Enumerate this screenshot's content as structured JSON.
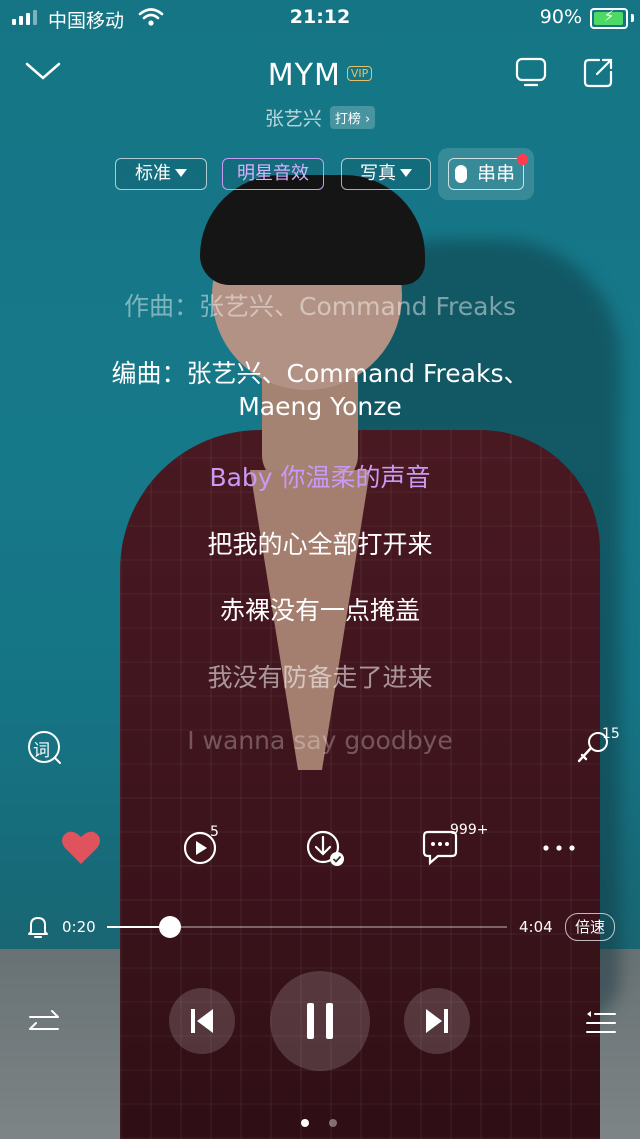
{
  "status_bar": {
    "carrier": "中国移动",
    "time": "21:12",
    "battery": "90%"
  },
  "header": {
    "title": "MYM",
    "vip_badge": "VIP",
    "artist": "张艺兴",
    "rank_label": "打榜 ›"
  },
  "modes": {
    "standard": "标准",
    "star_effect": "明星音效",
    "photo": "写真",
    "chuan": "串串"
  },
  "lyrics": [
    "作曲：张艺兴、Command Freaks",
    "编曲：张艺兴、Command Freaks、",
    "Maeng Yonze",
    "Baby 你温柔的声音",
    "把我的心全部打开来",
    "赤裸没有一点掩盖",
    "我没有防备走了进来",
    "I wanna say goodbye"
  ],
  "side": {
    "lyrics_icon_label": "词",
    "mic_count": "15"
  },
  "actions": {
    "video_count": "5",
    "comment_count": "999+"
  },
  "progress": {
    "current": "0:20",
    "total": "4:04",
    "fraction": 0.082,
    "speed_label": "倍速"
  },
  "colors": {
    "accent_purple": "#c89af5",
    "heart_red": "#e0525c",
    "vip_gold": "#e6c06a"
  },
  "icons": [
    "chevron-down-icon",
    "tv-icon",
    "share-icon",
    "lyrics-icon",
    "mic-icon",
    "heart-icon",
    "video-icon",
    "download-icon",
    "comment-icon",
    "more-icon",
    "alarm-icon",
    "shuffle-icon",
    "prev-icon",
    "pause-icon",
    "next-icon",
    "playlist-icon"
  ]
}
